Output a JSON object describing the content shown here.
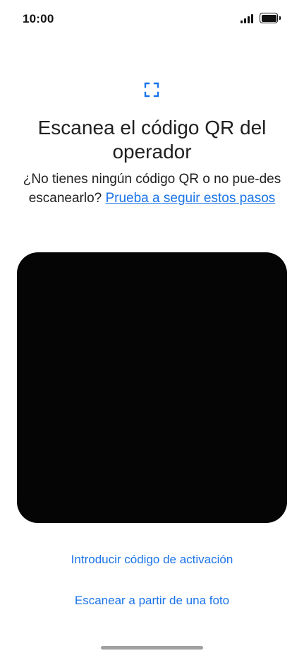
{
  "status_bar": {
    "time": "10:00",
    "signal_icon": "cellular-signal-icon",
    "battery_icon": "battery-full-icon"
  },
  "header": {
    "icon": "qr-scan-frame-icon",
    "title": "Escanea el código QR del operador",
    "subtitle_text": "¿No tienes ningún código QR o no pue-des escanearlo? ",
    "subtitle_link": "Prueba a seguir estos pasos"
  },
  "actions": {
    "enter_activation_code": "Introducir código de activación",
    "scan_from_photo": "Escanear a partir de una foto"
  },
  "colors": {
    "accent": "#1a73e8",
    "camera_background": "#050505",
    "text": "#1f1f1f"
  }
}
